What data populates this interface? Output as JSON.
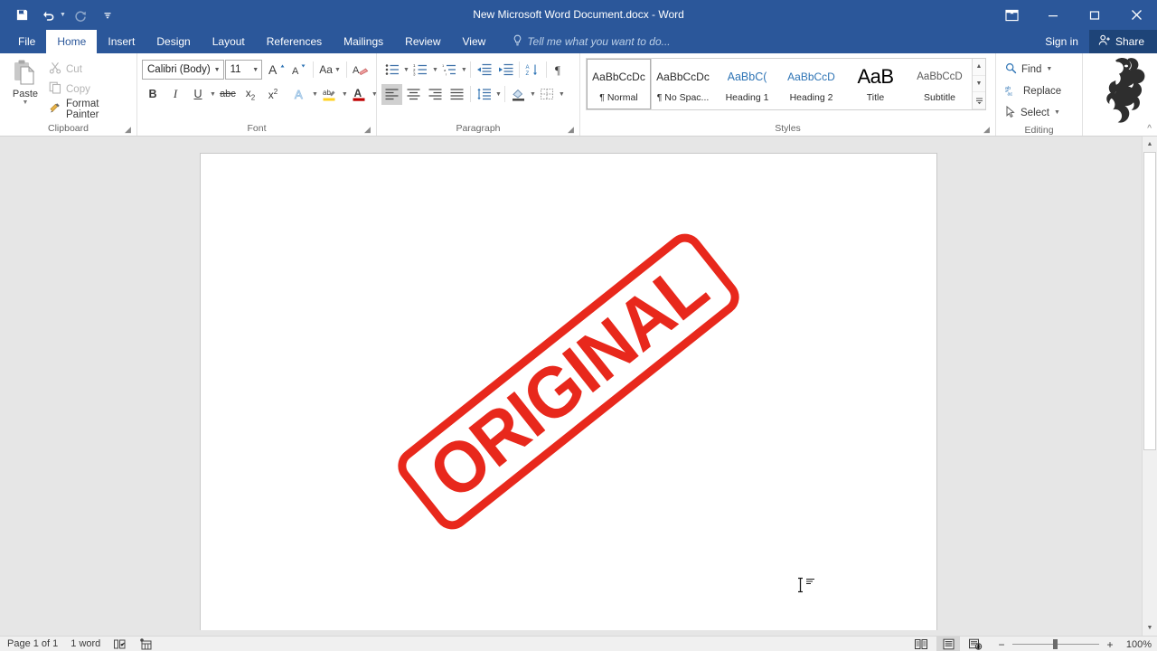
{
  "titlebar": {
    "document_title": "New Microsoft Word Document.docx - Word",
    "quick_access": [
      {
        "name": "save",
        "icon": "save-icon",
        "enabled": true
      },
      {
        "name": "undo",
        "icon": "undo-icon",
        "enabled": true
      },
      {
        "name": "redo",
        "icon": "redo-icon",
        "enabled": false
      },
      {
        "name": "customize-quick-access-toolbar",
        "icon": "chevron-down-icon",
        "enabled": true
      }
    ],
    "window_controls": [
      {
        "name": "ribbon-display-options",
        "glyph": "ribbon-options-icon"
      },
      {
        "name": "minimize",
        "glyph": "minimize-icon"
      },
      {
        "name": "restore",
        "glyph": "restore-icon"
      },
      {
        "name": "close",
        "glyph": "close-icon"
      }
    ],
    "accent_color": "#2b579a"
  },
  "tabs": [
    {
      "label": "File",
      "active": false
    },
    {
      "label": "Home",
      "active": true
    },
    {
      "label": "Insert",
      "active": false
    },
    {
      "label": "Design",
      "active": false
    },
    {
      "label": "Layout",
      "active": false
    },
    {
      "label": "References",
      "active": false
    },
    {
      "label": "Mailings",
      "active": false
    },
    {
      "label": "Review",
      "active": false
    },
    {
      "label": "View",
      "active": false
    }
  ],
  "tell_me": {
    "label": "Tell me what you want to do...",
    "icon": "lightbulb-icon"
  },
  "account": {
    "sign_in_label": "Sign in",
    "share_label": "Share",
    "share_icon": "share-person-icon"
  },
  "ribbon": {
    "clipboard": {
      "group_label": "Clipboard",
      "paste_label": "Paste",
      "items": [
        {
          "label": "Cut",
          "icon": "scissors-icon",
          "enabled": false
        },
        {
          "label": "Copy",
          "icon": "copy-icon",
          "enabled": false
        },
        {
          "label": "Format Painter",
          "icon": "paintbrush-icon",
          "enabled": true
        }
      ]
    },
    "font": {
      "group_label": "Font",
      "font_name": "Calibri (Body)",
      "font_size": "11",
      "buttons_row1": [
        {
          "name": "grow-font",
          "label": "A",
          "icon": "increase-font-size-icon"
        },
        {
          "name": "shrink-font",
          "label": "A",
          "icon": "decrease-font-size-icon"
        },
        {
          "name": "change-case",
          "label": "Aa",
          "icon": "change-case-icon"
        },
        {
          "name": "clear-formatting",
          "label": "",
          "icon": "clear-formatting-icon"
        }
      ],
      "buttons_row2": [
        {
          "name": "bold",
          "label": "B"
        },
        {
          "name": "italic",
          "label": "I"
        },
        {
          "name": "underline",
          "label": "U"
        },
        {
          "name": "strikethrough",
          "label": "abc"
        },
        {
          "name": "subscript",
          "label": "x₂"
        },
        {
          "name": "superscript",
          "label": "x²"
        },
        {
          "name": "text-effects",
          "label": "A"
        },
        {
          "name": "text-highlight-color",
          "label": "ab"
        },
        {
          "name": "font-color",
          "label": "A"
        }
      ]
    },
    "paragraph": {
      "group_label": "Paragraph",
      "buttons_row1": [
        {
          "name": "bullets",
          "icon": "bullet-list-icon"
        },
        {
          "name": "numbering",
          "icon": "numbered-list-icon"
        },
        {
          "name": "multilevel-list",
          "icon": "multilevel-list-icon"
        },
        {
          "name": "decrease-indent",
          "icon": "decrease-indent-icon"
        },
        {
          "name": "increase-indent",
          "icon": "increase-indent-icon"
        },
        {
          "name": "sort",
          "icon": "sort-az-icon"
        },
        {
          "name": "show-formatting-marks",
          "icon": "pilcrow-icon"
        }
      ],
      "buttons_row2": [
        {
          "name": "align-left",
          "icon": "align-left-icon",
          "active": true
        },
        {
          "name": "align-center",
          "icon": "align-center-icon",
          "active": false
        },
        {
          "name": "align-right",
          "icon": "align-right-icon",
          "active": false
        },
        {
          "name": "justify",
          "icon": "justify-icon",
          "active": false
        },
        {
          "name": "line-spacing",
          "icon": "line-spacing-icon",
          "active": false
        },
        {
          "name": "shading",
          "icon": "shading-icon",
          "active": false
        },
        {
          "name": "borders",
          "icon": "borders-icon",
          "active": false
        }
      ]
    },
    "styles": {
      "group_label": "Styles",
      "items": [
        {
          "preview": "AaBbCcDc",
          "name": "¶ Normal",
          "kind": "normal",
          "selected": true
        },
        {
          "preview": "AaBbCcDc",
          "name": "¶ No Spac...",
          "kind": "normal",
          "selected": false
        },
        {
          "preview": "AaBbC(",
          "name": "Heading 1",
          "kind": "h1",
          "selected": false
        },
        {
          "preview": "AaBbCcD",
          "name": "Heading 2",
          "kind": "h2",
          "selected": false
        },
        {
          "preview": "AaB",
          "name": "Title",
          "kind": "title",
          "selected": false
        },
        {
          "preview": "AaBbCcD",
          "name": "Subtitle",
          "kind": "subtitle",
          "selected": false
        }
      ],
      "scroll_up": "▲",
      "scroll_down": "▼",
      "more": "☰"
    },
    "editing": {
      "group_label": "Editing",
      "items": [
        {
          "label": "Find",
          "icon": "magnifier-icon",
          "has_caret": true
        },
        {
          "label": "Replace",
          "icon": "replace-icon",
          "has_caret": false
        },
        {
          "label": "Select",
          "icon": "cursor-arrow-icon",
          "has_caret": true
        }
      ]
    },
    "collapse_icon": "chevron-up-icon",
    "decoration_icon": "dragon-illustration"
  },
  "document": {
    "stamp": {
      "text": "ORIGINAL",
      "color": "#e8281c",
      "rotation_degrees": -38.5,
      "shape": "rounded-rectangle-border"
    },
    "cursor_icon": "text-ibeam-cursor"
  },
  "statusbar": {
    "page_indicator": "Page 1 of 1",
    "word_count": "1 word",
    "proofing_icon": "proofing-errors-icon",
    "macro_icon": "macro-record-icon",
    "view_buttons": [
      {
        "name": "read-mode",
        "icon": "read-mode-icon",
        "active": false
      },
      {
        "name": "print-layout",
        "icon": "print-layout-icon",
        "active": true
      },
      {
        "name": "web-layout",
        "icon": "web-layout-icon",
        "active": false
      }
    ],
    "zoom_out_label": "−",
    "zoom_in_label": "+",
    "zoom_level": "100%"
  }
}
